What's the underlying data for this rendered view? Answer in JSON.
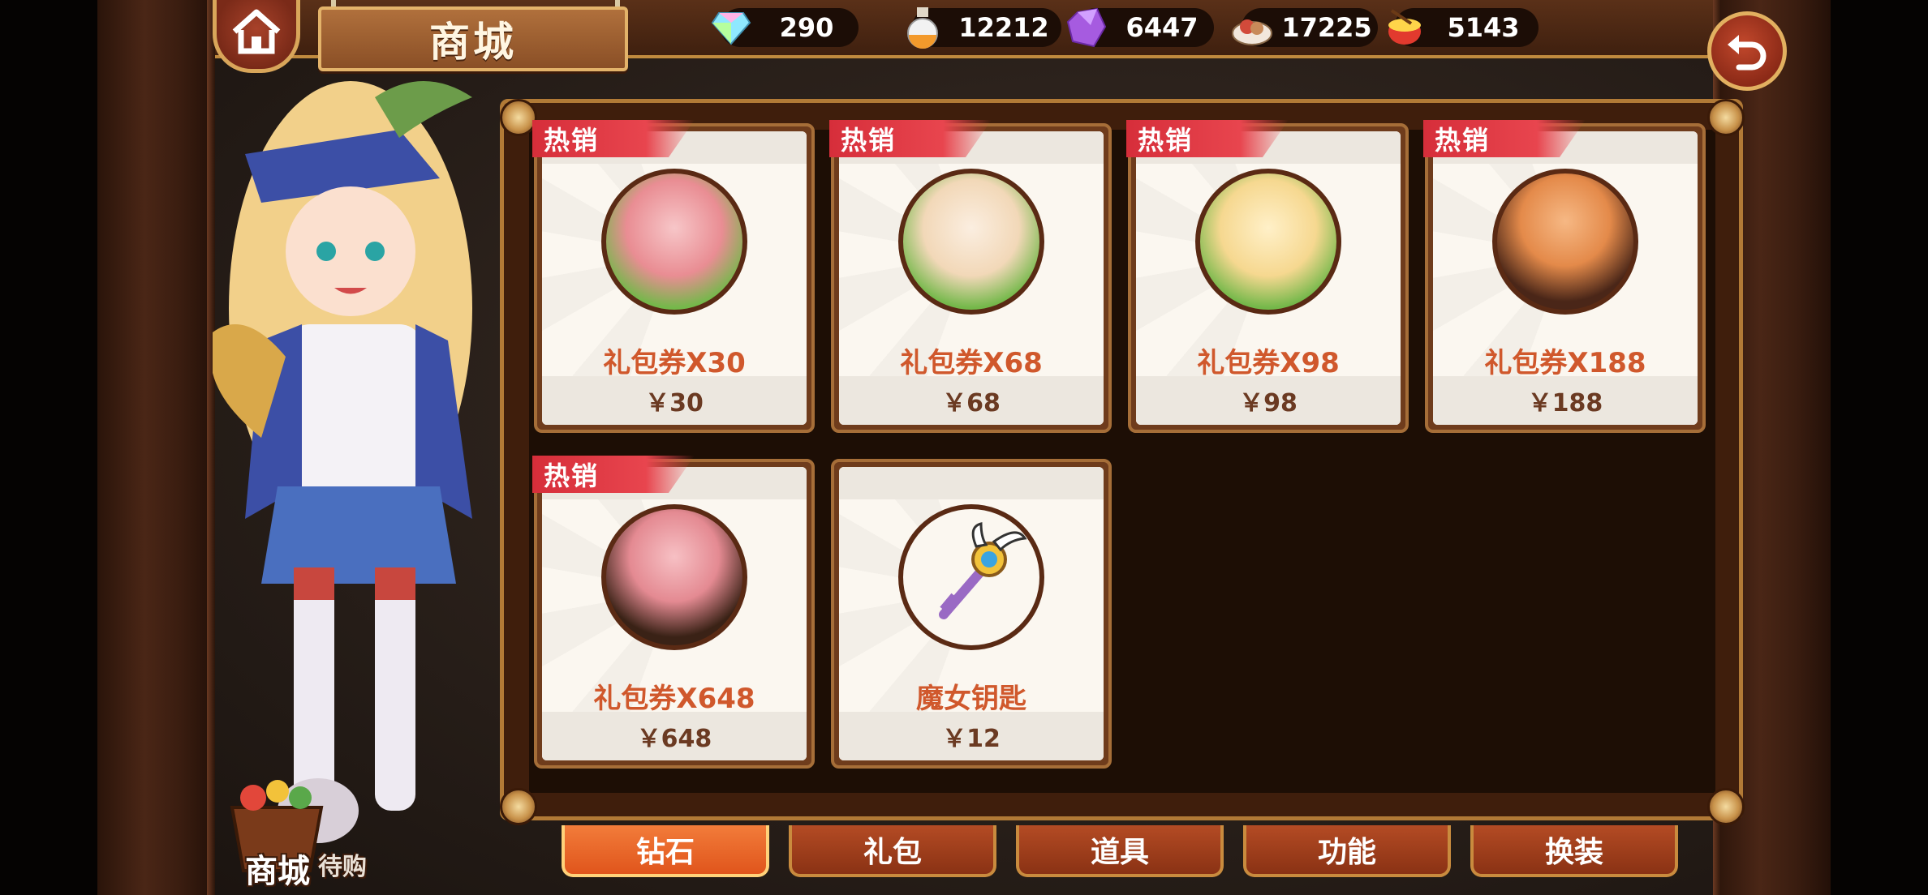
{
  "header": {
    "title": "商城",
    "currencies": [
      {
        "icon": "diamond-icon",
        "value": "290"
      },
      {
        "icon": "potion-icon",
        "value": "12212"
      },
      {
        "icon": "crystal-icon",
        "value": "6447"
      },
      {
        "icon": "food-icon",
        "value": "17225"
      },
      {
        "icon": "drum-icon",
        "value": "5143"
      }
    ]
  },
  "items": [
    {
      "name": "礼包券X30",
      "price": "￥30",
      "tag": "热销"
    },
    {
      "name": "礼包券X68",
      "price": "￥68",
      "tag": "热销"
    },
    {
      "name": "礼包券X98",
      "price": "￥98",
      "tag": "热销"
    },
    {
      "name": "礼包券X188",
      "price": "￥188",
      "tag": "热销"
    },
    {
      "name": "礼包券X648",
      "price": "￥648",
      "tag": "热销"
    },
    {
      "name": "魔女钥匙",
      "price": "￥12",
      "tag": ""
    }
  ],
  "tabs": [
    {
      "label": "钻石",
      "active": true
    },
    {
      "label": "礼包",
      "active": false
    },
    {
      "label": "道具",
      "active": false
    },
    {
      "label": "功能",
      "active": false
    },
    {
      "label": "换装",
      "active": false
    }
  ],
  "shop_bag": {
    "label": "商城",
    "sublabel": "待购"
  },
  "colors": {
    "accent": "#e0551c",
    "frame_gold": "#c98b3e",
    "hot_tag": "#d62e3a",
    "item_name": "#d0582c"
  }
}
